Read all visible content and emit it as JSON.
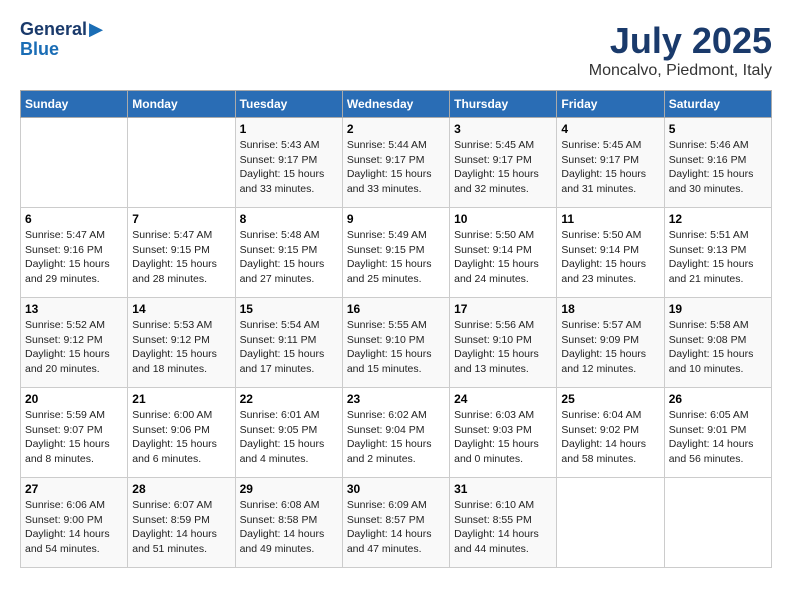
{
  "header": {
    "logo_line1": "General",
    "logo_line2": "Blue",
    "title": "July 2025",
    "subtitle": "Moncalvo, Piedmont, Italy"
  },
  "calendar": {
    "days_of_week": [
      "Sunday",
      "Monday",
      "Tuesday",
      "Wednesday",
      "Thursday",
      "Friday",
      "Saturday"
    ],
    "weeks": [
      [
        {
          "day": "",
          "detail": ""
        },
        {
          "day": "",
          "detail": ""
        },
        {
          "day": "1",
          "detail": "Sunrise: 5:43 AM\nSunset: 9:17 PM\nDaylight: 15 hours\nand 33 minutes."
        },
        {
          "day": "2",
          "detail": "Sunrise: 5:44 AM\nSunset: 9:17 PM\nDaylight: 15 hours\nand 33 minutes."
        },
        {
          "day": "3",
          "detail": "Sunrise: 5:45 AM\nSunset: 9:17 PM\nDaylight: 15 hours\nand 32 minutes."
        },
        {
          "day": "4",
          "detail": "Sunrise: 5:45 AM\nSunset: 9:17 PM\nDaylight: 15 hours\nand 31 minutes."
        },
        {
          "day": "5",
          "detail": "Sunrise: 5:46 AM\nSunset: 9:16 PM\nDaylight: 15 hours\nand 30 minutes."
        }
      ],
      [
        {
          "day": "6",
          "detail": "Sunrise: 5:47 AM\nSunset: 9:16 PM\nDaylight: 15 hours\nand 29 minutes."
        },
        {
          "day": "7",
          "detail": "Sunrise: 5:47 AM\nSunset: 9:15 PM\nDaylight: 15 hours\nand 28 minutes."
        },
        {
          "day": "8",
          "detail": "Sunrise: 5:48 AM\nSunset: 9:15 PM\nDaylight: 15 hours\nand 27 minutes."
        },
        {
          "day": "9",
          "detail": "Sunrise: 5:49 AM\nSunset: 9:15 PM\nDaylight: 15 hours\nand 25 minutes."
        },
        {
          "day": "10",
          "detail": "Sunrise: 5:50 AM\nSunset: 9:14 PM\nDaylight: 15 hours\nand 24 minutes."
        },
        {
          "day": "11",
          "detail": "Sunrise: 5:50 AM\nSunset: 9:14 PM\nDaylight: 15 hours\nand 23 minutes."
        },
        {
          "day": "12",
          "detail": "Sunrise: 5:51 AM\nSunset: 9:13 PM\nDaylight: 15 hours\nand 21 minutes."
        }
      ],
      [
        {
          "day": "13",
          "detail": "Sunrise: 5:52 AM\nSunset: 9:12 PM\nDaylight: 15 hours\nand 20 minutes."
        },
        {
          "day": "14",
          "detail": "Sunrise: 5:53 AM\nSunset: 9:12 PM\nDaylight: 15 hours\nand 18 minutes."
        },
        {
          "day": "15",
          "detail": "Sunrise: 5:54 AM\nSunset: 9:11 PM\nDaylight: 15 hours\nand 17 minutes."
        },
        {
          "day": "16",
          "detail": "Sunrise: 5:55 AM\nSunset: 9:10 PM\nDaylight: 15 hours\nand 15 minutes."
        },
        {
          "day": "17",
          "detail": "Sunrise: 5:56 AM\nSunset: 9:10 PM\nDaylight: 15 hours\nand 13 minutes."
        },
        {
          "day": "18",
          "detail": "Sunrise: 5:57 AM\nSunset: 9:09 PM\nDaylight: 15 hours\nand 12 minutes."
        },
        {
          "day": "19",
          "detail": "Sunrise: 5:58 AM\nSunset: 9:08 PM\nDaylight: 15 hours\nand 10 minutes."
        }
      ],
      [
        {
          "day": "20",
          "detail": "Sunrise: 5:59 AM\nSunset: 9:07 PM\nDaylight: 15 hours\nand 8 minutes."
        },
        {
          "day": "21",
          "detail": "Sunrise: 6:00 AM\nSunset: 9:06 PM\nDaylight: 15 hours\nand 6 minutes."
        },
        {
          "day": "22",
          "detail": "Sunrise: 6:01 AM\nSunset: 9:05 PM\nDaylight: 15 hours\nand 4 minutes."
        },
        {
          "day": "23",
          "detail": "Sunrise: 6:02 AM\nSunset: 9:04 PM\nDaylight: 15 hours\nand 2 minutes."
        },
        {
          "day": "24",
          "detail": "Sunrise: 6:03 AM\nSunset: 9:03 PM\nDaylight: 15 hours\nand 0 minutes."
        },
        {
          "day": "25",
          "detail": "Sunrise: 6:04 AM\nSunset: 9:02 PM\nDaylight: 14 hours\nand 58 minutes."
        },
        {
          "day": "26",
          "detail": "Sunrise: 6:05 AM\nSunset: 9:01 PM\nDaylight: 14 hours\nand 56 minutes."
        }
      ],
      [
        {
          "day": "27",
          "detail": "Sunrise: 6:06 AM\nSunset: 9:00 PM\nDaylight: 14 hours\nand 54 minutes."
        },
        {
          "day": "28",
          "detail": "Sunrise: 6:07 AM\nSunset: 8:59 PM\nDaylight: 14 hours\nand 51 minutes."
        },
        {
          "day": "29",
          "detail": "Sunrise: 6:08 AM\nSunset: 8:58 PM\nDaylight: 14 hours\nand 49 minutes."
        },
        {
          "day": "30",
          "detail": "Sunrise: 6:09 AM\nSunset: 8:57 PM\nDaylight: 14 hours\nand 47 minutes."
        },
        {
          "day": "31",
          "detail": "Sunrise: 6:10 AM\nSunset: 8:55 PM\nDaylight: 14 hours\nand 44 minutes."
        },
        {
          "day": "",
          "detail": ""
        },
        {
          "day": "",
          "detail": ""
        }
      ]
    ]
  }
}
